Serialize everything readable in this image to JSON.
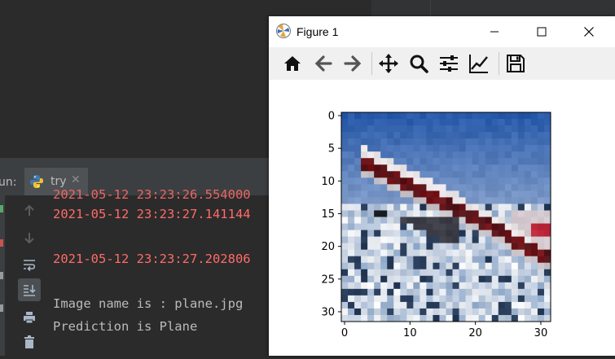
{
  "ide": {
    "run_label": "un:",
    "run_tab": {
      "label": "try",
      "close": "✕"
    },
    "console_lines": [
      {
        "text": "2021-05-12 23:23:26.554000",
        "kind": "err",
        "partial": true
      },
      {
        "text": "2021-05-12 23:23:27.141144",
        "kind": "err"
      },
      {
        "text": "2021-05-12 23:23:27.202806",
        "kind": "err"
      },
      {
        "text": "Image name is : plane.jpg",
        "kind": "out"
      },
      {
        "text": "Prediction is Plane",
        "kind": "out"
      }
    ],
    "tools": [
      "arrow-up-icon",
      "arrow-down-icon",
      "soft-wrap-icon",
      "scroll-to-end-icon",
      "print-icon",
      "trash-icon"
    ]
  },
  "figure": {
    "title": "Figure 1",
    "window_buttons": [
      "minimize",
      "maximize",
      "close"
    ],
    "toolbar": [
      "home-icon",
      "back-icon",
      "forward-icon",
      "pan-icon",
      "zoom-icon",
      "configure-subplots-icon",
      "edit-axis-icon",
      "save-icon"
    ]
  },
  "chart_data": {
    "type": "heatmap",
    "title": "",
    "content": "32x32 pixel image of an airplane (plane.jpg)",
    "xlabel": "",
    "ylabel": "",
    "xlim": [
      -0.5,
      31.5
    ],
    "ylim": [
      31.5,
      -0.5
    ],
    "xticks": [
      0,
      10,
      20,
      30
    ],
    "yticks": [
      0,
      5,
      10,
      15,
      20,
      25,
      30
    ],
    "grid": false
  },
  "colors": {
    "error_text": "#ff6b68",
    "normal_text": "#bbbbbb",
    "ide_bg": "#2b2b2b",
    "figure_bg": "#ffffff"
  }
}
